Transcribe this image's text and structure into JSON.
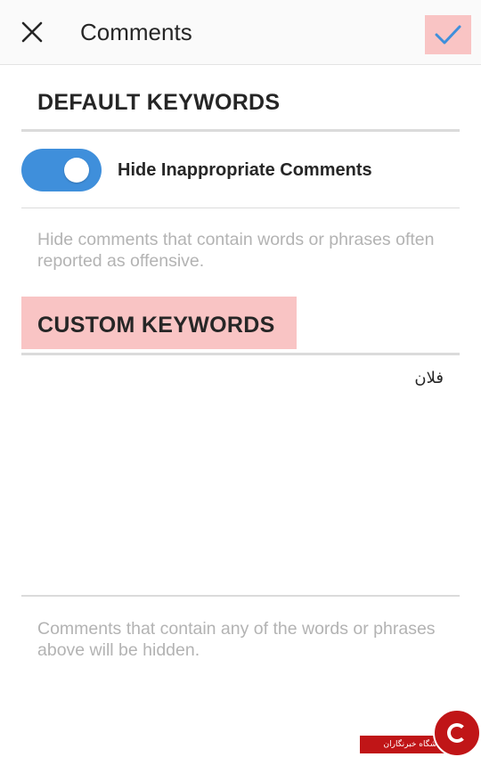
{
  "header": {
    "title": "Comments",
    "close_icon": "close-icon",
    "done_icon": "checkmark-icon"
  },
  "default_section": {
    "title": "DEFAULT KEYWORDS",
    "toggle_label": "Hide Inappropriate Comments",
    "toggle_on": true,
    "helper": "Hide comments that contain words or phrases often reported as offensive."
  },
  "custom_section": {
    "title": "CUSTOM KEYWORDS",
    "keywords_value": "فلان",
    "helper": "Comments that contain any of the words or phrases above will be hidden."
  },
  "watermark": {
    "text": "باشگاه خبرنگاران"
  },
  "colors": {
    "accent": "#3f8fdb",
    "highlight": "#f9c4c4",
    "helper_text": "#b3b3b3",
    "watermark": "#c01517"
  }
}
